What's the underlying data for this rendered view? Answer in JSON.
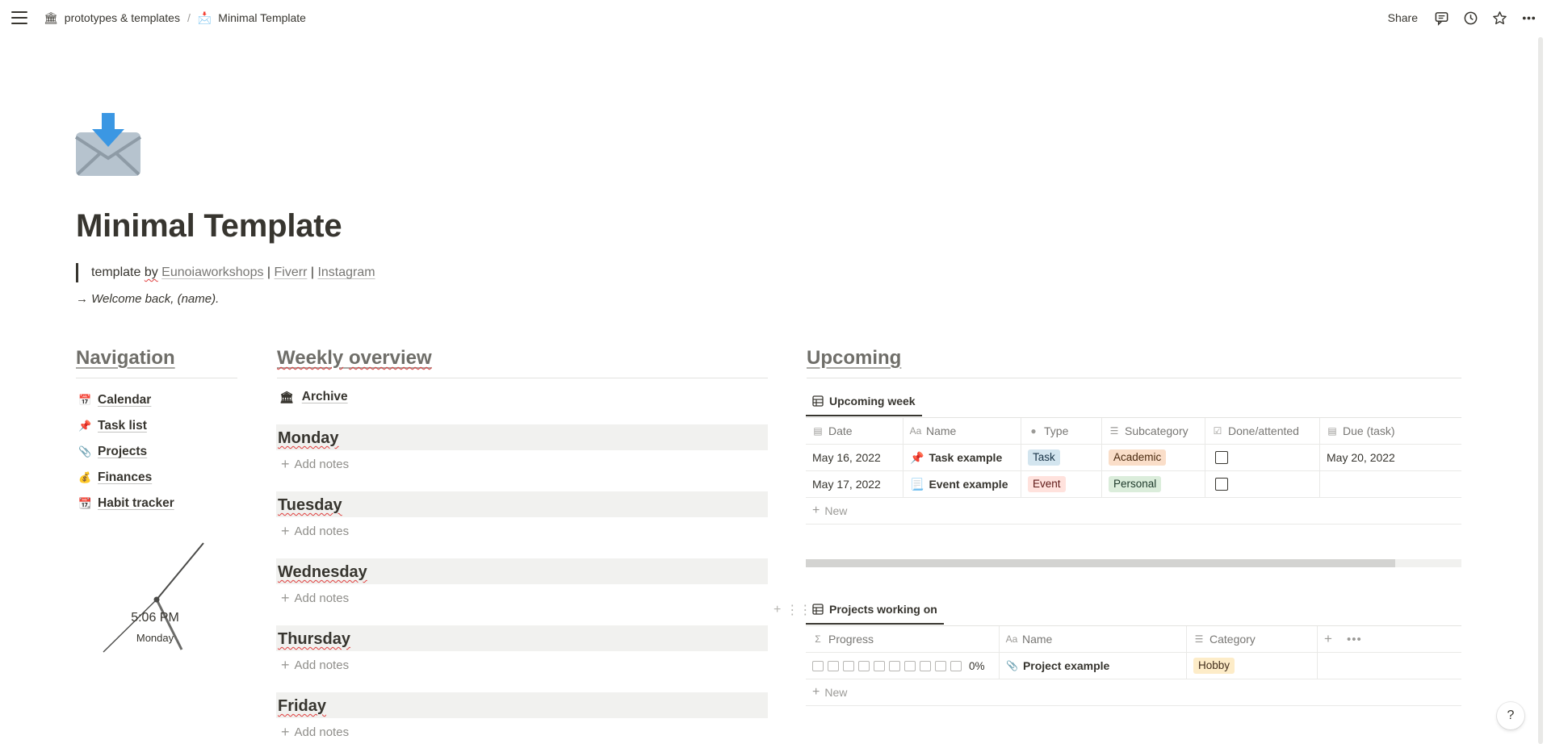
{
  "topbar": {
    "breadcrumb": [
      {
        "emoji": "🏛",
        "label": "prototypes & templates"
      },
      {
        "emoji": "📩",
        "label": "Minimal Template"
      }
    ],
    "separator": "/",
    "share_label": "Share",
    "icons": [
      "hamburger-icon",
      "comment-icon",
      "history-icon",
      "star-icon",
      "more-icon"
    ]
  },
  "page": {
    "icon": "envelope-with-arrow-icon",
    "title": "Minimal Template",
    "quote": {
      "prefix": "template ",
      "by": "by",
      "links": [
        "Eunoiaworkshops",
        "Fiverr",
        "Instagram"
      ],
      "sep": " | "
    },
    "welcome": "→ Welcome back, (name)."
  },
  "navigation": {
    "heading": "Navigation",
    "items": [
      {
        "emoji": "📅",
        "label": "Calendar"
      },
      {
        "emoji": "📌",
        "label": "Task list"
      },
      {
        "emoji": "📎",
        "label": "Projects"
      },
      {
        "emoji": "💰",
        "label": "Finances"
      },
      {
        "emoji": "📆",
        "label": "Habit tracker"
      }
    ],
    "clock": {
      "time": "5:06 PM",
      "day": "Monday"
    }
  },
  "weekly": {
    "heading": "Weekly overview",
    "archive": {
      "emoji": "🏛",
      "label": "Archive"
    },
    "add_notes": "Add notes",
    "days": [
      "Monday",
      "Tuesday",
      "Wednesday",
      "Thursday",
      "Friday"
    ]
  },
  "upcoming": {
    "heading": "Upcoming",
    "week_tab": "Upcoming week",
    "week_columns": [
      "Date",
      "Name",
      "Type",
      "Subcategory",
      "Done/attented",
      "Due (task)"
    ],
    "week_rows": [
      {
        "date": "May 16, 2022",
        "emoji": "📌",
        "name": "Task example",
        "type": "Task",
        "sub": "Academic",
        "due": "May 20, 2022"
      },
      {
        "date": "May 17, 2022",
        "emoji": "📃",
        "name": "Event example",
        "type": "Event",
        "sub": "Personal",
        "due": ""
      }
    ],
    "new_label": "New",
    "projects_tab": "Projects working on",
    "projects_columns": [
      "Progress",
      "Name",
      "Category"
    ],
    "projects_rows": [
      {
        "progress": "0%",
        "emoji": "📎",
        "name": "Project example",
        "category": "Hobby"
      }
    ]
  },
  "help": "?",
  "colors": {
    "text": "#37352f",
    "muted": "#787774",
    "heading": "#6f6e69",
    "day_bg": "#f1f1ef",
    "misspell": "#e03e3e"
  }
}
